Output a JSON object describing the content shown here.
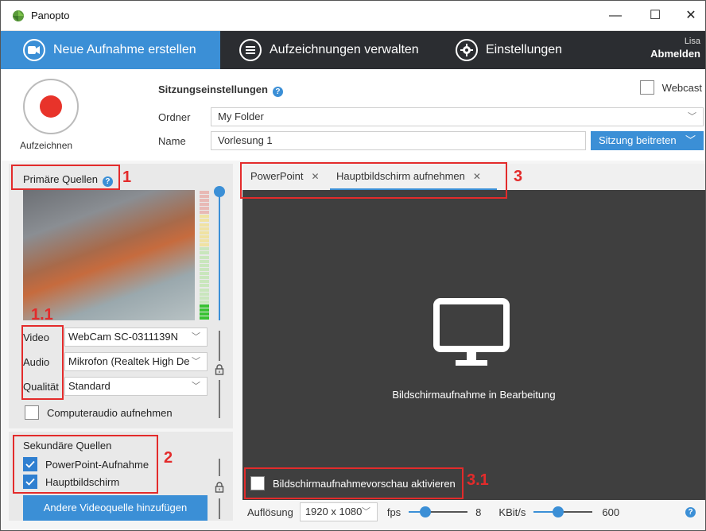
{
  "window": {
    "title": "Panopto",
    "controls": {
      "minimize": "—",
      "maximize": "☐",
      "close": "✕"
    }
  },
  "nav": {
    "tabs": [
      {
        "label": "Neue Aufnahme erstellen",
        "icon": "camera-icon"
      },
      {
        "label": "Aufzeichnungen verwalten",
        "icon": "list-icon"
      },
      {
        "label": "Einstellungen",
        "icon": "gear-icon"
      }
    ],
    "user": "Lisa",
    "logout": "Abmelden"
  },
  "record": {
    "label": "Aufzeichnen"
  },
  "session": {
    "title": "Sitzungseinstellungen",
    "webcast_label": "Webcast",
    "folder_label": "Ordner",
    "folder_value": "My Folder",
    "name_label": "Name",
    "name_value": "Vorlesung 1",
    "join_label": "Sitzung beitreten"
  },
  "primary": {
    "title": "Primäre Quellen",
    "video_label": "Video",
    "video_value": "WebCam SC-0311139N",
    "audio_label": "Audio",
    "audio_value": "Mikrofon (Realtek High De",
    "quality_label": "Qualität",
    "quality_value": "Standard",
    "computer_audio_label": "Computeraudio aufnehmen"
  },
  "secondary": {
    "title": "Sekundäre Quellen",
    "items": [
      {
        "label": "PowerPoint-Aufnahme",
        "checked": true
      },
      {
        "label": "Hauptbildschirm",
        "checked": true
      }
    ],
    "add_button": "Andere Videoquelle hinzufügen"
  },
  "preview": {
    "tabs": [
      {
        "label": "PowerPoint"
      },
      {
        "label": "Hauptbildschirm aufnehmen"
      }
    ],
    "status_text": "Bildschirmaufnahme in Bearbeitung",
    "enable_preview_label": "Bildschirmaufnahmevorschau aktivieren"
  },
  "bottom": {
    "resolution_label": "Auflösung",
    "resolution_value": "1920 x 1080",
    "fps_label": "fps",
    "fps_value": "8",
    "kbits_label": "KBit/s",
    "kbits_value": "600"
  },
  "annotations": [
    "1",
    "1.1",
    "2",
    "3",
    "3.1"
  ],
  "colors": {
    "accent": "#3b8fd6",
    "navbar": "#2b2d31",
    "record": "#e8332a",
    "annotation": "#e32b2b",
    "stage": "#3f3f3f"
  }
}
